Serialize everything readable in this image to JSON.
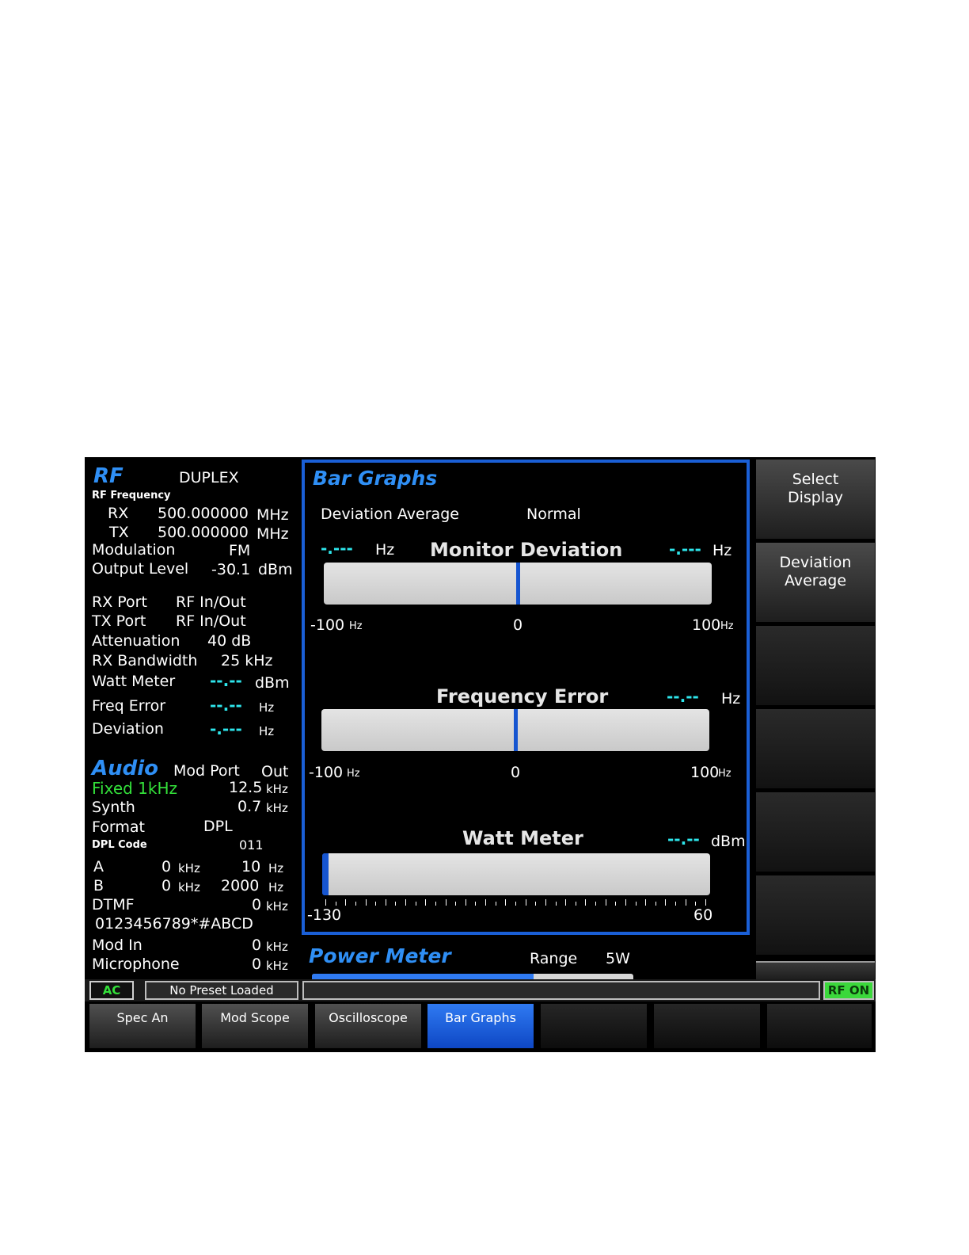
{
  "rf": {
    "title": "RF",
    "mode": "DUPLEX",
    "freq_label": "RF Frequency",
    "rx_label": "RX",
    "rx_value": "500.000000",
    "rx_unit": "MHz",
    "tx_label": "TX",
    "tx_value": "500.000000",
    "tx_unit": "MHz",
    "modulation_label": "Modulation",
    "modulation_value": "FM",
    "output_label": "Output Level",
    "output_value": "-30.1",
    "output_unit": "dBm",
    "rx_port_label": "RX Port",
    "rx_port_value": "RF In/Out",
    "tx_port_label": "TX Port",
    "tx_port_value": "RF In/Out",
    "atten_label": "Attenuation",
    "atten_value": "40 dB",
    "rxbw_label": "RX Bandwidth",
    "rxbw_value": "25 kHz",
    "watt_label": "Watt Meter",
    "watt_value": "--.--",
    "watt_unit": "dBm",
    "ferr_label": "Freq Error",
    "ferr_value": "--.--",
    "ferr_unit": "Hz",
    "dev_label": "Deviation",
    "dev_value": "-.---",
    "dev_unit": "Hz"
  },
  "audio": {
    "title": "Audio",
    "mod_port_label": "Mod Port",
    "mod_port_value": "Out",
    "fixed_label": "Fixed 1kHz",
    "fixed_value": "12.5",
    "fixed_unit": "kHz",
    "synth_label": "Synth",
    "synth_value": "0.7",
    "synth_unit": "kHz",
    "format_label": "Format",
    "format_value": "DPL",
    "dpl_label": "DPL Code",
    "dpl_value": "011",
    "a_label": "A",
    "a_val1": "0",
    "a_unit1": "kHz",
    "a_val2": "10",
    "a_unit2": "Hz",
    "b_label": "B",
    "b_val1": "0",
    "b_unit1": "kHz",
    "b_val2": "2000",
    "b_unit2": "Hz",
    "dtmf_label": "DTMF",
    "dtmf_value": "0",
    "dtmf_unit": "kHz",
    "dtmf_string": "0123456789*#ABCD",
    "modin_label": "Mod In",
    "modin_value": "0",
    "modin_unit": "kHz",
    "mic_label": "Microphone",
    "mic_value": "0",
    "mic_unit": "kHz"
  },
  "bar_graphs": {
    "title": "Bar Graphs",
    "dev_avg_label": "Deviation Average",
    "dev_avg_value": "Normal",
    "monitor": {
      "title": "Monitor Deviation",
      "left_value": "-.---",
      "left_unit": "Hz",
      "right_value": "-.---",
      "right_unit": "Hz",
      "min_label": "-100",
      "min_unit": "Hz",
      "mid_label": "0",
      "max_label": "100",
      "max_unit": "Hz",
      "level": 0.5
    },
    "freq_error": {
      "title": "Frequency Error",
      "right_value": "--.--",
      "right_unit": "Hz",
      "min_label": "-100",
      "min_unit": "Hz",
      "mid_label": "0",
      "max_label": "100",
      "max_unit": "Hz",
      "level": 0.5
    },
    "watt_meter": {
      "title": "Watt Meter",
      "right_value": "--.--",
      "right_unit": "dBm",
      "min_label": "-130",
      "max_label": "60",
      "level": 0.0
    }
  },
  "power_meter": {
    "title": "Power Meter",
    "range_label": "Range",
    "range_value": "5W"
  },
  "softkeys": [
    {
      "label_line1": "Select",
      "label_line2": "Display"
    },
    {
      "label_line1": "Deviation",
      "label_line2": "Average"
    }
  ],
  "status": {
    "ac": "AC",
    "preset": "No Preset Loaded",
    "rf_on": "RF ON"
  },
  "tabs": [
    {
      "label": "Spec An"
    },
    {
      "label": "Mod Scope"
    },
    {
      "label": "Oscilloscope"
    },
    {
      "label": "Bar Graphs"
    }
  ],
  "colors": {
    "accent_blue": "#2f8ff5",
    "cyan_readout": "#2ee6ec",
    "green_text": "#33e03a",
    "panel_border": "#1a5fd6"
  }
}
